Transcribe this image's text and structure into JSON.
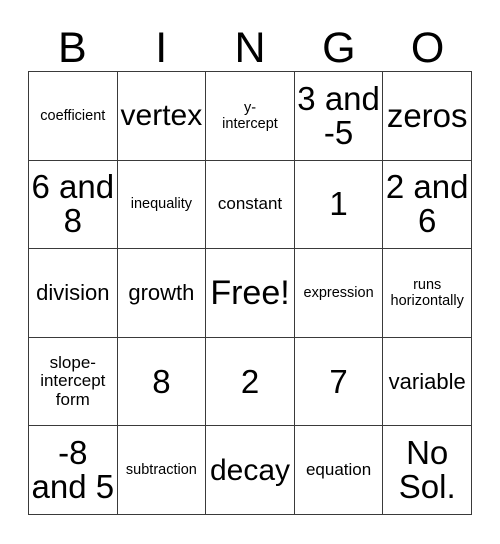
{
  "card": {
    "title": "BINGO",
    "header_letters": [
      "B",
      "I",
      "N",
      "G",
      "O"
    ],
    "border_color": "#3a3a3a",
    "background_color": "#ffffff",
    "text_color": "#000000",
    "columns": 5,
    "rows": 5,
    "free_space": "Free!",
    "free_space_position": "center",
    "cells": [
      {
        "text": "coefficient",
        "size": "xs",
        "nowrap": true
      },
      {
        "text": "vertex",
        "size": "xl",
        "nowrap": true
      },
      {
        "text": "y-\nintercept",
        "size": "xs",
        "nowrap": false
      },
      {
        "text": "3 and\n-5",
        "size": "xxl",
        "nowrap": false
      },
      {
        "text": "zeros",
        "size": "xxl",
        "nowrap": true
      },
      {
        "text": "6 and\n8",
        "size": "xxl",
        "nowrap": false
      },
      {
        "text": "inequality",
        "size": "xs",
        "nowrap": true
      },
      {
        "text": "constant",
        "size": "sm",
        "nowrap": true
      },
      {
        "text": "1",
        "size": "xxl",
        "nowrap": true
      },
      {
        "text": "2 and\n6",
        "size": "xxl",
        "nowrap": false
      },
      {
        "text": "division",
        "size": "md",
        "nowrap": true
      },
      {
        "text": "growth",
        "size": "md",
        "nowrap": true
      },
      {
        "text": "Free!",
        "size": "free",
        "nowrap": true
      },
      {
        "text": "expression",
        "size": "xs",
        "nowrap": true
      },
      {
        "text": "runs\nhorizontally",
        "size": "xs",
        "nowrap": false
      },
      {
        "text": "slope-\nintercept\nform",
        "size": "sm",
        "nowrap": false
      },
      {
        "text": "8",
        "size": "xxl",
        "nowrap": true
      },
      {
        "text": "2",
        "size": "xxl",
        "nowrap": true
      },
      {
        "text": "7",
        "size": "xxl",
        "nowrap": true
      },
      {
        "text": "variable",
        "size": "md",
        "nowrap": true
      },
      {
        "text": "-8\nand 5",
        "size": "xxl",
        "nowrap": false
      },
      {
        "text": "subtraction",
        "size": "xs",
        "nowrap": true
      },
      {
        "text": "decay",
        "size": "xl",
        "nowrap": true
      },
      {
        "text": "equation",
        "size": "sm",
        "nowrap": true
      },
      {
        "text": "No\nSol.",
        "size": "xxl",
        "nowrap": false
      }
    ]
  }
}
